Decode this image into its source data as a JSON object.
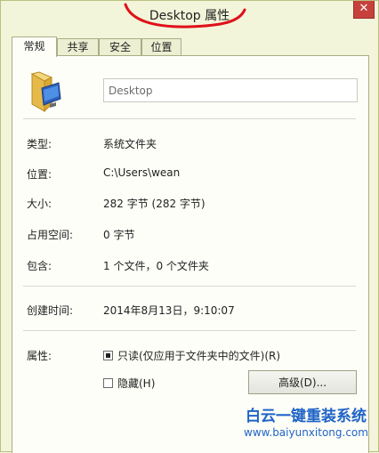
{
  "window": {
    "title": "Desktop 属性",
    "close_glyph": "✕"
  },
  "tabs": [
    {
      "label": "常规",
      "active": true
    },
    {
      "label": "共享",
      "active": false
    },
    {
      "label": "安全",
      "active": false
    },
    {
      "label": "位置",
      "active": false
    }
  ],
  "general": {
    "folder_icon": "folder-desktop-icon",
    "name_value": "Desktop",
    "rows": [
      {
        "label": "类型:",
        "value": "系统文件夹"
      },
      {
        "label": "位置:",
        "value": "C:\\Users\\wean"
      },
      {
        "label": "大小:",
        "value": "282 字节 (282 字节)"
      },
      {
        "label": "占用空间:",
        "value": "0 字节"
      },
      {
        "label": "包含:",
        "value": "1 个文件，0 个文件夹"
      },
      {
        "label": "创建时间:",
        "value": "2014年8月13日，9:10:07"
      }
    ],
    "attributes_label": "属性:",
    "readonly": {
      "label": "只读(仅应用于文件夹中的文件)(R)",
      "checked": "indeterminate"
    },
    "hidden": {
      "label": "隐藏(H)",
      "checked": false
    },
    "advanced_label": "高级(D)..."
  },
  "watermark": {
    "title": "白云一键重装系统",
    "url": "www.baiyunxitong.com"
  },
  "colors": {
    "window_bg": "#f2f5d9",
    "close_red": "#c7413c",
    "annotation_red": "#e0101a",
    "watermark_blue": "#1f63c6"
  }
}
